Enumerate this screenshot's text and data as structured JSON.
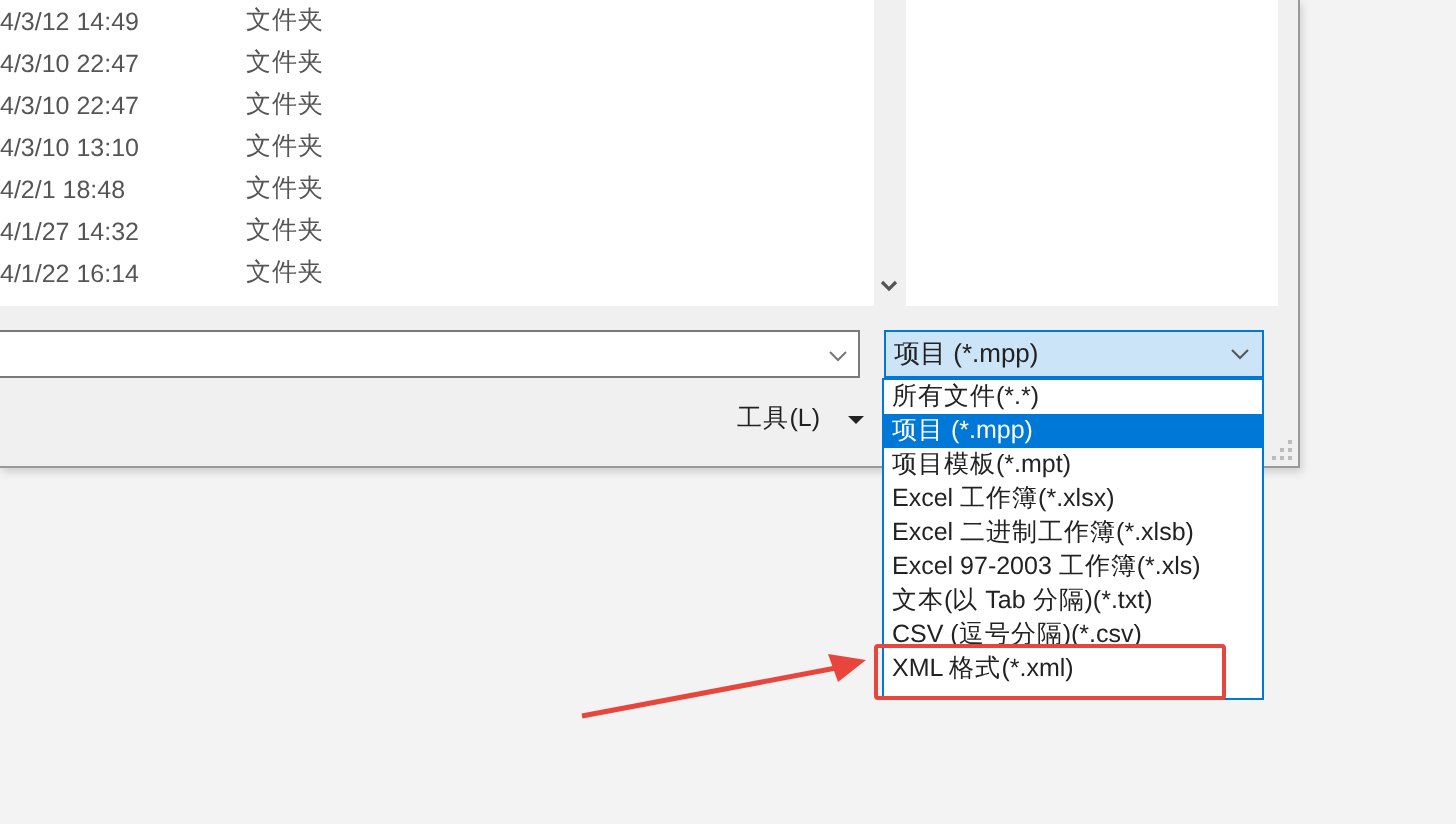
{
  "file_list": {
    "rows": [
      {
        "modified": "4/3/12 14:49",
        "type": "文件夹"
      },
      {
        "modified": "4/3/10 22:47",
        "type": "文件夹"
      },
      {
        "modified": "4/3/10 22:47",
        "type": "文件夹"
      },
      {
        "modified": "4/3/10 13:10",
        "type": "文件夹"
      },
      {
        "modified": "4/2/1 18:48",
        "type": "文件夹"
      },
      {
        "modified": "4/1/27 14:32",
        "type": "文件夹"
      },
      {
        "modified": "4/1/22 16:14",
        "type": "文件夹"
      }
    ]
  },
  "file_type": {
    "value": "项目 (*.mpp)",
    "expanded": true,
    "options": [
      {
        "label": "所有文件(*.*)",
        "selected": false
      },
      {
        "label": "项目 (*.mpp)",
        "selected": true
      },
      {
        "label": "项目模板(*.mpt)",
        "selected": false
      },
      {
        "label": "Excel 工作簿(*.xlsx)",
        "selected": false
      },
      {
        "label": "Excel 二进制工作簿(*.xlsb)",
        "selected": false
      },
      {
        "label": "Excel 97-2003 工作簿(*.xls)",
        "selected": false
      },
      {
        "label": "文本(以 Tab 分隔)(*.txt)",
        "selected": false
      },
      {
        "label": "CSV (逗号分隔)(*.csv)",
        "selected": false
      },
      {
        "label": "XML 格式(*.xml)",
        "selected": false
      }
    ]
  },
  "tools_button": {
    "label": "工具(L)"
  }
}
